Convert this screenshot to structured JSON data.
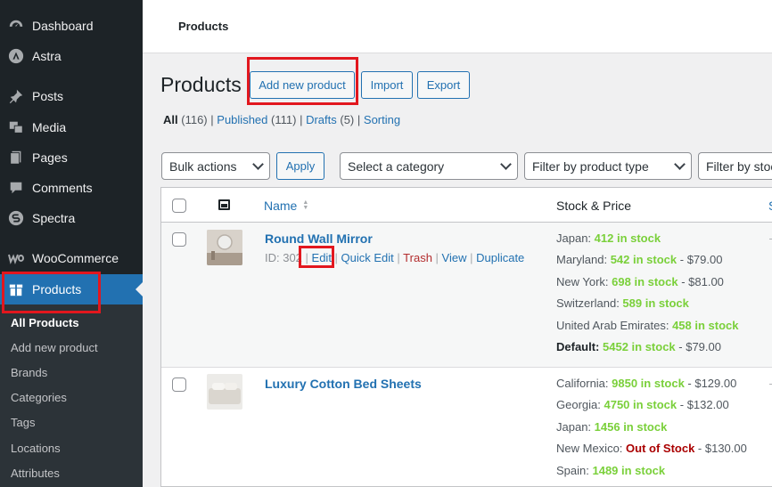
{
  "sidebar": {
    "items": [
      {
        "label": "Dashboard",
        "icon": "dashboard-icon"
      },
      {
        "label": "Astra",
        "icon": "astra-icon"
      },
      {
        "label": "Posts",
        "icon": "pin-icon"
      },
      {
        "label": "Media",
        "icon": "media-icon"
      },
      {
        "label": "Pages",
        "icon": "pages-icon"
      },
      {
        "label": "Comments",
        "icon": "comments-icon"
      },
      {
        "label": "Spectra",
        "icon": "spectra-icon"
      },
      {
        "label": "WooCommerce",
        "icon": "woocommerce-icon"
      },
      {
        "label": "Products",
        "icon": "products-icon"
      }
    ],
    "submenu": [
      "All Products",
      "Add new product",
      "Brands",
      "Categories",
      "Tags",
      "Locations",
      "Attributes"
    ]
  },
  "topbar": {
    "title": "Products"
  },
  "header": {
    "title": "Products",
    "add_new": "Add new product",
    "import": "Import",
    "export": "Export"
  },
  "filters": {
    "all": "All",
    "all_count": "(116)",
    "published": "Published",
    "published_count": "(111)",
    "drafts": "Drafts",
    "drafts_count": "(5)",
    "sorting": "Sorting",
    "sep": "|"
  },
  "controls": {
    "bulk_actions": "Bulk actions",
    "apply": "Apply",
    "category": "Select a category",
    "product_type": "Filter by product type",
    "stock_status": "Filter by stoc"
  },
  "table": {
    "col_name": "Name",
    "col_stock": "Stock & Price",
    "col_next": "S",
    "rows": [
      {
        "name": "Round Wall Mirror",
        "id_text": "ID: 302",
        "actions": {
          "edit": "Edit",
          "quick_edit": "Quick Edit",
          "trash": "Trash",
          "view": "View",
          "duplicate": "Duplicate"
        },
        "stock": [
          {
            "loc": "Japan: ",
            "status": "412 in stock",
            "price": ""
          },
          {
            "loc": "Maryland: ",
            "status": "542 in stock",
            "price": " - $79.00"
          },
          {
            "loc": "New York: ",
            "status": "698 in stock",
            "price": " - $81.00"
          },
          {
            "loc": "Switzerland: ",
            "status": "589 in stock",
            "price": ""
          },
          {
            "loc": "United Arab Emirates: ",
            "status": "458 in stock",
            "price": ""
          },
          {
            "loc": "Default: ",
            "status": "5452 in stock",
            "price": " - $79.00"
          }
        ]
      },
      {
        "name": "Luxury Cotton Bed Sheets",
        "stock": [
          {
            "loc": "California: ",
            "status": "9850 in stock",
            "price": " - $129.00"
          },
          {
            "loc": "Georgia: ",
            "status": "4750 in stock",
            "price": " - $132.00"
          },
          {
            "loc": "Japan: ",
            "status": "1456 in stock",
            "price": ""
          },
          {
            "loc": "New Mexico: ",
            "status": "Out of Stock",
            "price": " - $130.00"
          },
          {
            "loc": "Spain: ",
            "status": "1489 in stock",
            "price": ""
          }
        ]
      }
    ]
  },
  "colors": {
    "accent": "#2271b1",
    "sidebar": "#1d2327",
    "in_stock": "#7ad03a",
    "out_of_stock": "#aa0000",
    "highlight": "#e2171e"
  }
}
